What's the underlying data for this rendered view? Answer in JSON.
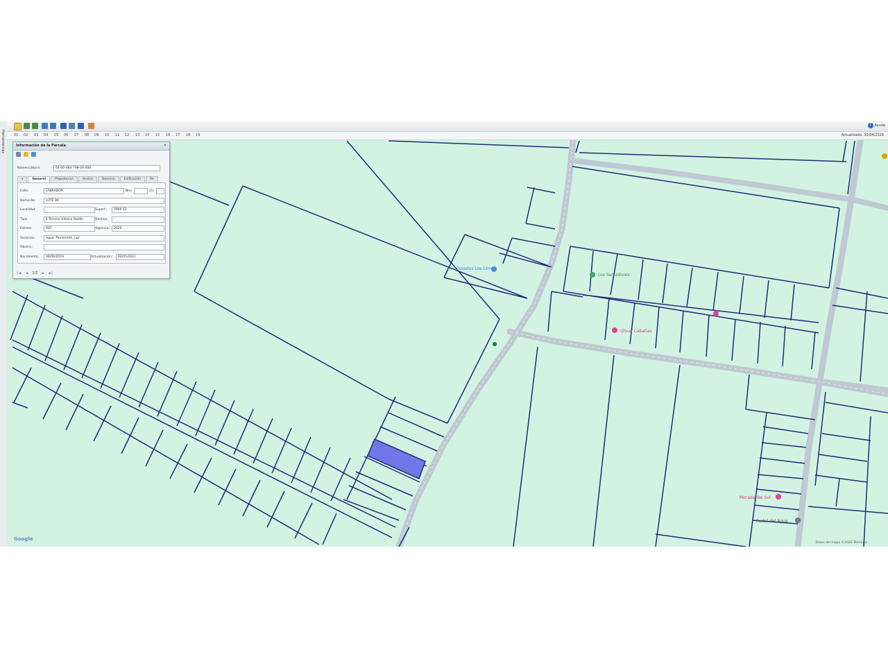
{
  "toolbar": {
    "help_label": "Ayuda"
  },
  "left_strip": {
    "label": "Herramientas"
  },
  "number_bar": {
    "numbers": [
      "01",
      "02",
      "03",
      "04",
      "05",
      "06",
      "07",
      "08",
      "09",
      "10",
      "11",
      "12",
      "13",
      "14",
      "15",
      "16",
      "17",
      "18",
      "19"
    ],
    "updated": "Actualizado: 30/04/2026"
  },
  "panel": {
    "title": "Información de la Parcela",
    "close_icon": "close-icon",
    "nomenclatura_label": "Nomenclatura:",
    "nomenclatura_value": "04-00-464-798-00-000",
    "tabs": [
      "General",
      "Propietarios",
      "Avalúo",
      "Dominio",
      "Edificación",
      "Re"
    ],
    "fields": {
      "calle_label": "Calle:",
      "calle_value": "LABRADOR",
      "nro_label": "Nro:",
      "ch_label": "Ch:",
      "domicilio_label": "Domicilio:",
      "domicilio_value": "LOTE 06",
      "localidad_label": "Localidad:",
      "localidad_value": "",
      "superf_label": "Superf.:",
      "superf_value": "2000.12",
      "tipo_label": "Tipo:",
      "tipo_value": "1-Terreno Urbano Baldío",
      "destino_label": "Destino:",
      "destino_value": "-",
      "estrato_label": "Estrato:",
      "estrato_value": "007",
      "vigencia_label": "Vigencia:",
      "vigencia_value": "2020",
      "servicios_label": "Servicios:",
      "servicios_value": "Agua, Pavimento, Luz",
      "observ_label": "Observ.:",
      "observ_value": "",
      "nacimiento_label": "Nacimiento:",
      "nacimiento_value": "06/09/2019",
      "actualizacion_label": "Actualización:",
      "actualizacion_value": "02/05/2021"
    },
    "pager": {
      "first": "|◄",
      "prev": "◄",
      "page": "1/1",
      "next": "►",
      "last": "►|"
    }
  },
  "map": {
    "places": [
      "Posadas Los Olmos",
      "Los Seguidores",
      "Olivar Cabañas",
      "Morada del Sol",
      "Portal del Agua"
    ],
    "credit": "Datos del mapa ©2026   Términos",
    "logo": "Google"
  },
  "colors": {
    "map_bg": "#d3f3e2",
    "parcel_line": "#1f2a7a",
    "road": "#bfc9d2",
    "selected": "#6f78e6"
  }
}
